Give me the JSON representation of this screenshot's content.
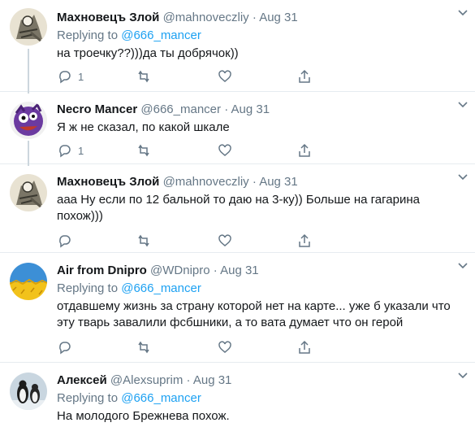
{
  "tweets": [
    {
      "name": "Махновецъ Злой",
      "handle": "@mahnoveczliy",
      "date": "Aug 31",
      "reply_prefix": "Replying to",
      "reply_to": "@666_mancer",
      "text": "на троечку??)))да ты добрячок))",
      "reply_count": "1",
      "avatar": "skeleton-illustration"
    },
    {
      "name": "Necro Mancer",
      "handle": "@666_mancer",
      "date": "Aug 31",
      "text": "Я ж не сказал, по какой шкале",
      "reply_count": "1",
      "avatar": "purple-monster"
    },
    {
      "name": "Махновецъ Злой",
      "handle": "@mahnoveczliy",
      "date": "Aug 31",
      "text": "ааа Ну если по 12 бальной то даю на 3-ку)) Больше на гагарина похож)))",
      "reply_count": "",
      "avatar": "skeleton-illustration"
    },
    {
      "name": "Air from Dnipro",
      "handle": "@WDnipro",
      "date": "Aug 31",
      "reply_prefix": "Replying to",
      "reply_to": "@666_mancer",
      "text": "отдавшему жизнь за страну которой нет на карте... уже б указали что эту тварь завалили фсбшники, а то вата думает что он герой",
      "reply_count": "",
      "avatar": "wheat-field-sky"
    },
    {
      "name": "Алексей",
      "handle": "@Alexsuprim",
      "date": "Aug 31",
      "reply_prefix": "Replying to",
      "reply_to": "@666_mancer",
      "text": "На молодого Брежнева похож.",
      "reply_count": "",
      "avatar": "penguins"
    }
  ],
  "colors": {
    "accent": "#1da1f2",
    "text": "#14171a",
    "muted": "#657786",
    "divider": "#e6ecf0",
    "thread_line": "#ccd6dd"
  },
  "icons": [
    "reply-icon",
    "retweet-icon",
    "like-icon",
    "share-icon",
    "chevron-down-icon"
  ]
}
